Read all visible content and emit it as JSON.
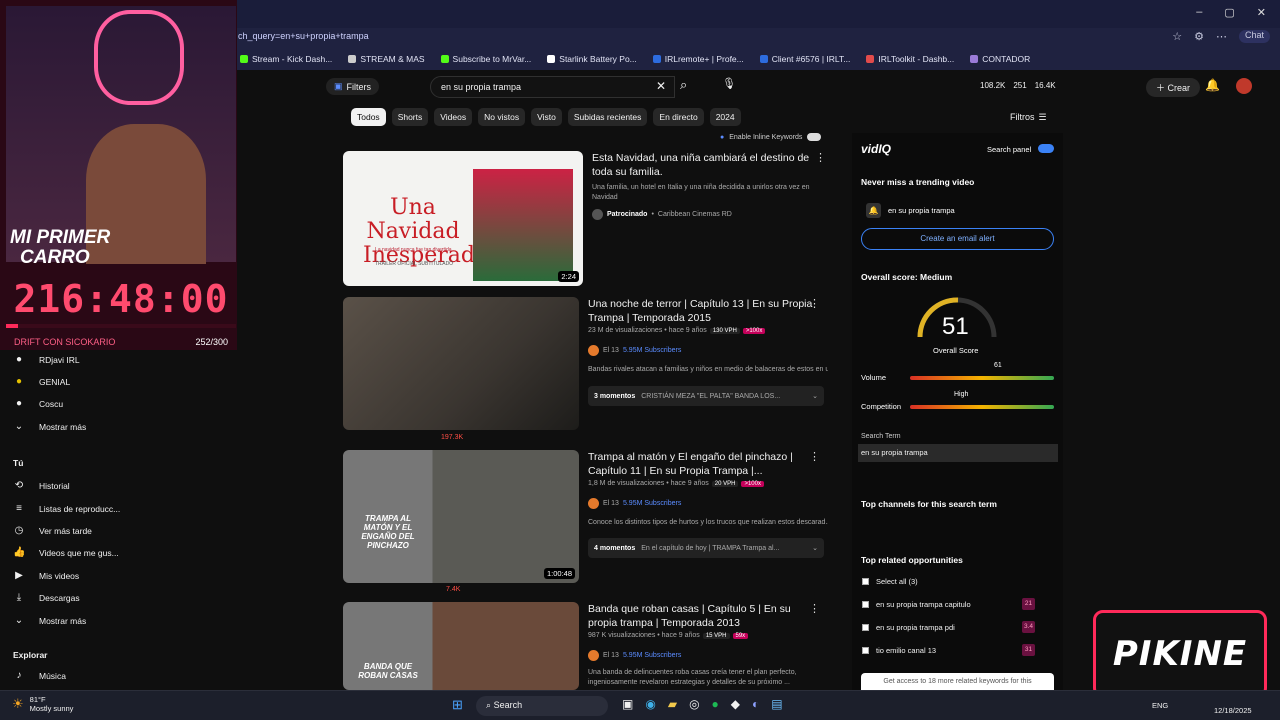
{
  "browser": {
    "url": "ch_query=en+su+propia+trampa",
    "chat_label": "Chat",
    "bookmarks": [
      "Stream - Kick Dash...",
      "STREAM & MAS",
      "Subscribe to MrVar...",
      "Starlink Battery Po...",
      "IRLremote+ | Profe...",
      "Client #6576 | IRLT...",
      "IRLToolkit - Dashb...",
      "CONTADOR"
    ]
  },
  "youtube": {
    "filters_label": "Filters",
    "search_value": "en su propia trampa",
    "header_stats": [
      "108.2K",
      "251",
      "16.4K"
    ],
    "create_label": "Crear",
    "chips": [
      "Todos",
      "Shorts",
      "Videos",
      "No vistos",
      "Visto",
      "Subidas recientes",
      "En directo",
      "2024"
    ],
    "filtros_label": "Filtros",
    "inline_keywords": "Enable Inline Keywords",
    "results": [
      {
        "title": "Esta Navidad, una niña cambiará el destino de toda su familia.",
        "desc": "Una familia, un hotel en Italia y una niña decidida a unirlos otra vez en Navidad",
        "sponsor": "Patrocinado",
        "channel": "Caribbean Cinemas RD",
        "duration": "2:24",
        "thumb_title": "Una Navidad Inesperada",
        "thumb_sub": "La navidad nunca fue tan divertida.",
        "thumb_foot": "TRÁILER OFICIAL SUBTITULADO"
      },
      {
        "title": "Una noche de terror | Capítulo 13 | En su Propia Trampa | Temporada 2015",
        "meta": "23 M de visualizaciones • hace 9 años",
        "vph": "130 VPH",
        "mult": ">100x",
        "channel": "El 13",
        "subs": "5.95M Subscribers",
        "desc": "Bandas rivales atacan a familias y niños en medio de balaceras de estos en u...",
        "moments": "3 momentos",
        "moments_text": "CRISTIÁN MEZA \"EL PALTA\" BANDA LOS...",
        "views": "197.3K"
      },
      {
        "title": "Trampa al matón y El engaño del pinchazo | Capítulo 11 | En su Propia Trampa |...",
        "meta": "1,8 M de visualizaciones • hace 9 años",
        "vph": "20 VPH",
        "mult": ">100x",
        "channel": "El 13",
        "subs": "5.95M Subscribers",
        "desc": "Conoce los distintos tipos de hurtos y los trucos que realizan estos descarad...",
        "moments": "4 momentos",
        "moments_text": "En el capítulo de hoy | TRAMPA Trampa al...",
        "duration": "1:00:48",
        "views": "7.4K",
        "thumb_text": "TRAMPA AL MATÓN Y EL ENGAÑO DEL PINCHAZO"
      },
      {
        "title": "Banda que roban casas | Capítulo 5 | En su propia trampa | Temporada 2013",
        "meta": "987 K visualizaciones • hace 9 años",
        "vph": "15 VPH",
        "mult": "59x",
        "channel": "El 13",
        "subs": "5.95M Subscribers",
        "desc": "Una banda de delincuentes roba casas creía tener el plan perfecto, ingeniosamente revelaron estrategias y detalles de su próximo ...",
        "thumb_text": "BANDA QUE ROBAN CASAS"
      }
    ]
  },
  "vidiq": {
    "logo": "vidIQ",
    "search_panel": "Search panel",
    "trend_title": "Never miss a trending video",
    "trend_term": "en su propia trampa",
    "email_alert": "Create an email alert",
    "overall": "Overall score: Medium",
    "score": "51",
    "score_label": "Overall Score",
    "volume_label": "Volume",
    "volume_val": "61",
    "competition_label": "Competition",
    "competition_val": "High",
    "term_title": "Search Term",
    "term_value": "en su propia trampa",
    "channels_title": "Top channels for this search term",
    "related_title": "Top related opportunities",
    "select_all": "Select all (3)",
    "keywords": [
      {
        "kw": "en su propia trampa capitulo",
        "score": "21"
      },
      {
        "kw": "en su propia trampa pdi",
        "score": "3.4"
      },
      {
        "kw": "tio emilio canal 13",
        "score": "31"
      }
    ],
    "more": "Get access to 18 more related keywords for this"
  },
  "sidebar": {
    "subs": [
      "RDjavi IRL",
      "GENIAL",
      "Coscu"
    ],
    "mostrar": "Mostrar más",
    "tu": "Tú",
    "items": [
      "Historial",
      "Listas de reproducc...",
      "Ver más tarde",
      "Videos que me gus...",
      "Mis videos",
      "Descargas",
      "Mostrar más"
    ],
    "explorar": "Explorar",
    "musica": "Música"
  },
  "overlay": {
    "logo_top": "MI PRIMER",
    "logo_bottom": "CARRO",
    "timer": "216:48:00",
    "goal_label": "DRIFT CON SICOKARIO",
    "goal_value": "252/300"
  },
  "taskbar": {
    "temp": "81°F",
    "weather": "Mostly sunny",
    "search": "Search",
    "lang": "ENG",
    "time": "12/18/2025"
  },
  "brand": "PIKINE"
}
